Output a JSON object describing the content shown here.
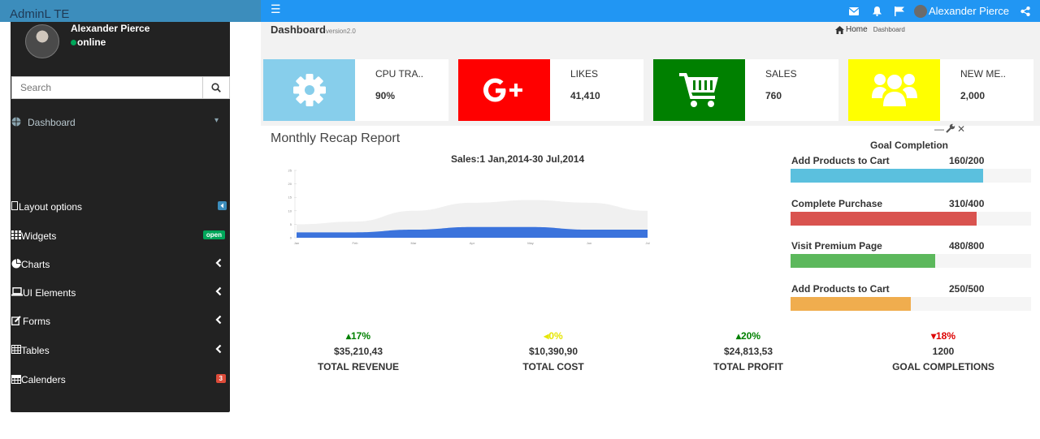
{
  "app": {
    "logo": "AdminL TE"
  },
  "navbar": {
    "user_name": "Alexander Pierce",
    "icons": [
      "menu-icon",
      "envelope-icon",
      "bell-icon",
      "flag-icon",
      "share-icon"
    ]
  },
  "sidebar": {
    "user": {
      "name": "Alexander Pierce",
      "status": "online"
    },
    "search": {
      "placeholder": "Search"
    },
    "dashboard_label": "Dashboard",
    "items": [
      {
        "label": "Layout options"
      },
      {
        "label": "Widgets",
        "badge": "open",
        "badge_color": "#00a65a"
      },
      {
        "label": "Charts"
      },
      {
        "label": "UI Elements"
      },
      {
        "label": "Forms"
      },
      {
        "label": "Tables"
      },
      {
        "label": "Calenders",
        "badge": "3",
        "badge_color": "#dd4b39"
      }
    ]
  },
  "header": {
    "title": "Dashboard",
    "subtitle": "version2.0",
    "breadcrumb_home": "Home",
    "breadcrumb_current": "Dashboard"
  },
  "info_boxes": [
    {
      "label": "CPU TRA..",
      "value": "90%",
      "color": "#87ceeb",
      "icon": "gear-icon"
    },
    {
      "label": "LIKES",
      "value": "41,410",
      "color": "#ff0000",
      "icon": "google-plus-icon"
    },
    {
      "label": "SALES",
      "value": "760",
      "color": "#008000",
      "icon": "cart-icon"
    },
    {
      "label": "NEW ME..",
      "value": "2,000",
      "color": "#ffff00",
      "icon": "users-icon"
    }
  ],
  "report": {
    "title": "Monthly Recap Report",
    "chart_title": "Sales:1 Jan,2014-30 Jul,2014"
  },
  "chart_data": {
    "type": "area",
    "categories": [
      "Jan",
      "Feb",
      "Mar",
      "Apr",
      "May",
      "Jun",
      "Jul"
    ],
    "series": [
      {
        "values": [
          5,
          6,
          10,
          13,
          14,
          13,
          10
        ]
      },
      {
        "values": [
          2,
          2,
          3,
          4,
          4,
          3,
          3
        ]
      }
    ],
    "y_ticks": [
      "0",
      "5",
      "10",
      "15",
      "20",
      "25"
    ],
    "ylim": [
      0,
      25
    ],
    "colors": [
      "#f0f0f0",
      "#3b73dc"
    ]
  },
  "goals": {
    "title": "Goal Completion",
    "items": [
      {
        "label": "Add Products to Cart",
        "value": "160/200",
        "fraction": 0.8,
        "color": "#5bc0de"
      },
      {
        "label": "Complete Purchase",
        "value": "310/400",
        "fraction": 0.775,
        "color": "#d9534f"
      },
      {
        "label": "Visit Premium Page",
        "value": "480/800",
        "fraction": 0.6,
        "color": "#5cb85c"
      },
      {
        "label": "Add Products to Cart",
        "value": "250/500",
        "fraction": 0.5,
        "color": "#f0ad4e"
      }
    ]
  },
  "stats": [
    {
      "pct": "17%",
      "amount": "$35,210,43",
      "label": "TOTAL REVENUE",
      "dir": "up",
      "color": "#008000"
    },
    {
      "pct": "0%",
      "amount": "$10,390,90",
      "label": "TOTAL COST",
      "dir": "left",
      "color": "#e6e600"
    },
    {
      "pct": "20%",
      "amount": "$24,813,53",
      "label": "TOTAL PROFIT",
      "dir": "up",
      "color": "#008000"
    },
    {
      "pct": "18%",
      "amount": "1200",
      "label": "GOAL COMPLETIONS",
      "dir": "down",
      "color": "#dd0000"
    }
  ]
}
